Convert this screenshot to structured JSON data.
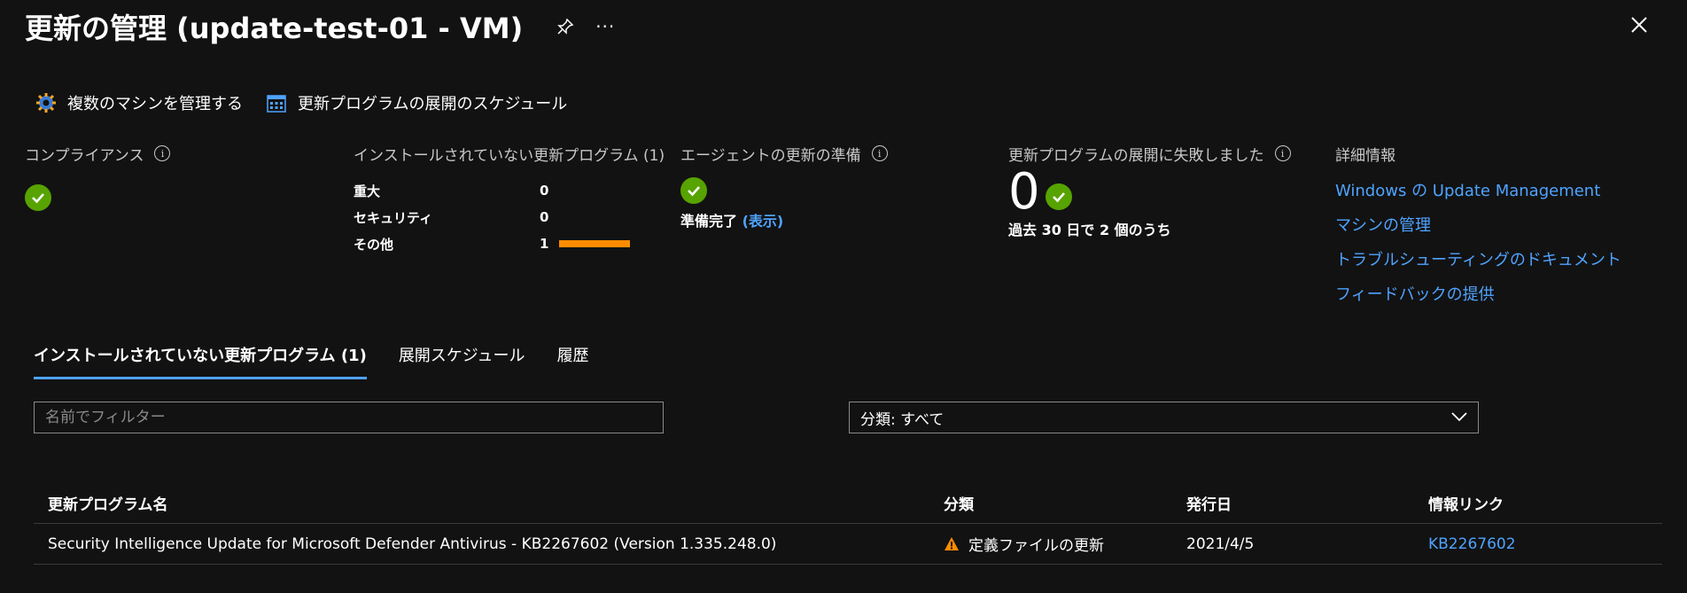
{
  "header": {
    "title": "更新の管理 (update-test-01 - VM)",
    "more_label": "···"
  },
  "toolbar": {
    "manage_multiple": "複数のマシンを管理する",
    "schedule": "更新プログラムの展開のスケジュール"
  },
  "compliance": {
    "title": "コンプライアンス"
  },
  "missing": {
    "title": "インストールされていない更新プログラム (1)",
    "rows": [
      {
        "name": "重大",
        "value": "0",
        "fraction": 0
      },
      {
        "name": "セキュリティ",
        "value": "0",
        "fraction": 0
      },
      {
        "name": "その他",
        "value": "1",
        "fraction": 1
      }
    ]
  },
  "agent": {
    "title": "エージェントの更新の準備",
    "status": "準備完了",
    "show_link": "(表示)"
  },
  "failed": {
    "title": "更新プログラムの展開に失敗しました",
    "count": "0",
    "subtitle": "過去 30 日で 2 個のうち"
  },
  "details": {
    "title": "詳細情報",
    "links": [
      "Windows の Update Management",
      "マシンの管理",
      "トラブルシューティングのドキュメント",
      "フィードバックの提供"
    ]
  },
  "tabs": [
    {
      "label": "インストールされていない更新プログラム (1)",
      "active": true
    },
    {
      "label": "展開スケジュール",
      "active": false
    },
    {
      "label": "履歴",
      "active": false
    }
  ],
  "filter": {
    "placeholder": "名前でフィルター",
    "value": ""
  },
  "classification": {
    "selected": "分類: すべて"
  },
  "table": {
    "columns": [
      "更新プログラム名",
      "分類",
      "発行日",
      "情報リンク"
    ],
    "rows": [
      {
        "name": "Security Intelligence Update for Microsoft Defender Antivirus - KB2267602 (Version 1.335.248.0)",
        "classification": "定義ファイルの更新",
        "date": "2021/4/5",
        "link": "KB2267602"
      }
    ]
  },
  "colors": {
    "accent": "#4fa3ff",
    "success": "#57a300",
    "warning": "#ff8c00",
    "background": "#121212"
  }
}
